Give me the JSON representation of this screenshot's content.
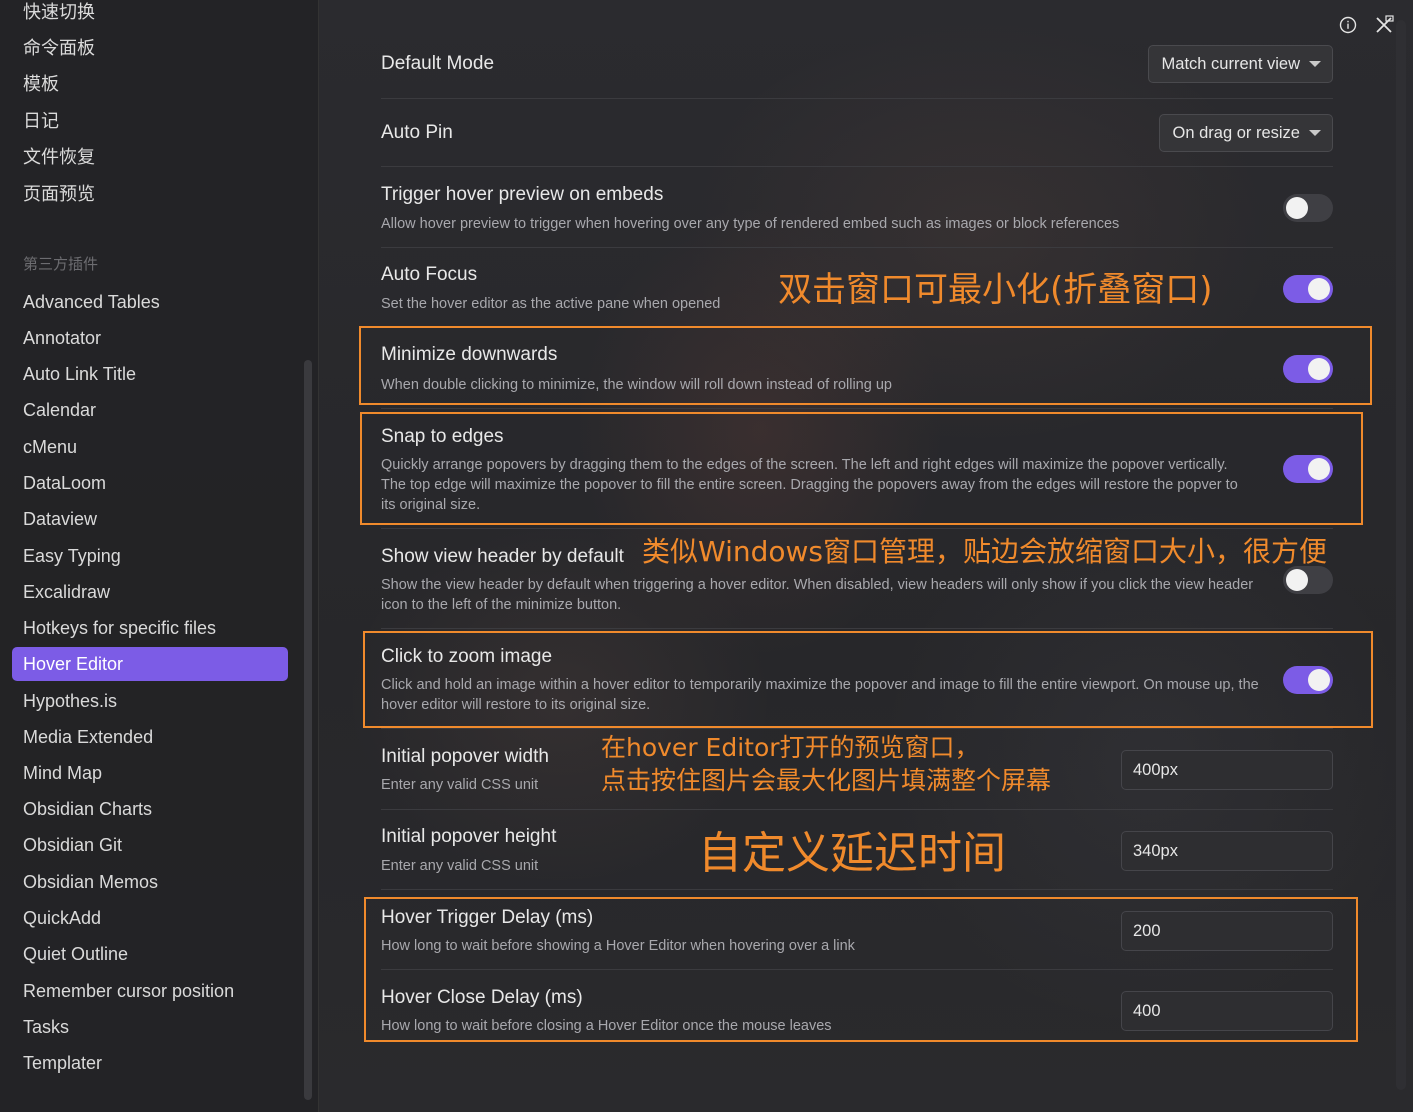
{
  "sidebar": {
    "top_items": [
      {
        "label": "快速切换"
      },
      {
        "label": "命令面板"
      },
      {
        "label": "模板"
      },
      {
        "label": "日记"
      },
      {
        "label": "文件恢复"
      },
      {
        "label": "页面预览"
      }
    ],
    "section_heading": "第三方插件",
    "plugins": [
      {
        "label": "Advanced Tables"
      },
      {
        "label": "Annotator"
      },
      {
        "label": "Auto Link Title"
      },
      {
        "label": "Calendar"
      },
      {
        "label": "cMenu"
      },
      {
        "label": "DataLoom"
      },
      {
        "label": "Dataview"
      },
      {
        "label": "Easy Typing"
      },
      {
        "label": "Excalidraw"
      },
      {
        "label": "Hotkeys for specific files"
      },
      {
        "label": "Hover Editor"
      },
      {
        "label": "Hypothes.is"
      },
      {
        "label": "Media Extended"
      },
      {
        "label": "Mind Map"
      },
      {
        "label": "Obsidian Charts"
      },
      {
        "label": "Obsidian Git"
      },
      {
        "label": "Obsidian Memos"
      },
      {
        "label": "QuickAdd"
      },
      {
        "label": "Quiet Outline"
      },
      {
        "label": "Remember cursor position"
      },
      {
        "label": "Tasks"
      },
      {
        "label": "Templater"
      }
    ],
    "active_plugin": "Hover Editor"
  },
  "settings": {
    "default_mode": {
      "title": "Default Mode",
      "value": "Match current view"
    },
    "auto_pin": {
      "title": "Auto Pin",
      "value": "On drag or resize"
    },
    "trigger_embeds": {
      "title": "Trigger hover preview on embeds",
      "desc": "Allow hover preview to trigger when hovering over any type of rendered embed such as images or block references",
      "enabled": false
    },
    "auto_focus": {
      "title": "Auto Focus",
      "desc": "Set the hover editor as the active pane when opened",
      "enabled": true
    },
    "minimize_downwards": {
      "title": "Minimize downwards",
      "desc": "When double clicking to minimize, the window will roll down instead of rolling up",
      "enabled": true
    },
    "snap_to_edges": {
      "title": "Snap to edges",
      "desc": "Quickly arrange popovers by dragging them to the edges of the screen. The left and right edges will maximize the popover vertically. The top edge will maximize the popover to fill the entire screen. Dragging the popovers away from the edges will restore the popver to its original size.",
      "enabled": true
    },
    "show_view_header": {
      "title": "Show view header by default",
      "desc": "Show the view header by default when triggering a hover editor. When disabled, view headers will only show if you click the view header icon to the left of the minimize button.",
      "enabled": false
    },
    "click_to_zoom": {
      "title": "Click to zoom image",
      "desc": "Click and hold an image within a hover editor to temporarily maximize the popover and image to fill the entire viewport. On mouse up, the hover editor will restore to its original size.",
      "enabled": true
    },
    "popover_width": {
      "title": "Initial popover width",
      "desc": "Enter any valid CSS unit",
      "value": "400px"
    },
    "popover_height": {
      "title": "Initial popover height",
      "desc": "Enter any valid CSS unit",
      "value": "340px"
    },
    "trigger_delay": {
      "title": "Hover Trigger Delay (ms)",
      "desc": "How long to wait before showing a Hover Editor when hovering over a link",
      "value": "200"
    },
    "close_delay": {
      "title": "Hover Close Delay (ms)",
      "desc": "How long to wait before closing a Hover Editor once the mouse leaves",
      "value": "400"
    }
  },
  "annotations": {
    "minimize": "双击窗口可最小化(折叠窗口)",
    "snap": "类似Windows窗口管理，贴边会放缩窗口大小，很方便",
    "zoom_line1": "在hover Editor打开的预览窗口，",
    "zoom_line2": "点击按住图片会最大化图片填满整个屏幕",
    "delay": "自定义延迟时间"
  },
  "colors": {
    "accent": "#7c5ce6",
    "annotation": "#f08a2c"
  },
  "icons": [
    "info-icon",
    "close-pin-icon",
    "caret-down-icon"
  ]
}
